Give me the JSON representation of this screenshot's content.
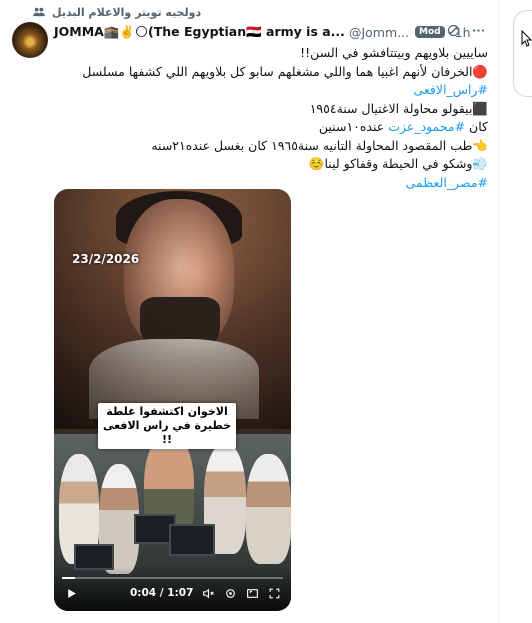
{
  "community": {
    "label": "دولجيه تويتر والاعلام البديل",
    "icon": "people-icon"
  },
  "tweet": {
    "author_name": "JOMMA🕋✌️🌕(The Egyptian🇪🇬 army is a...",
    "handle": "@Jomm...",
    "badge": "Mod",
    "separator": "·",
    "time": "1h",
    "text_lines": [
      "ساييين بلاويهم وبيتتافشو في السن!!",
      "🔴الخرفان لأنهم اغبيا هما واللي مشغلهم سابو كل بلاويهم اللي كشفها مسلسل",
      "#راس_الافعى",
      "⬛بيقولو محاولة الاغتيال سنة١٩٥٤",
      "كان #محمود_عزت عنده١٠سنين",
      "👈طب المقصود المحاولة التانيه سنة١٩٦٥ كان بغسل عنده٢١سنه",
      "💨وشكو في الحيطة وقفاكو لينا☺️",
      "#مصر_العظمى"
    ]
  },
  "video": {
    "overlay_date": "23/2/2026",
    "overlay_caption": "الاخوان اكتشفوا غلطة خطيرة في راس الافعى !!",
    "current_time": "0:04",
    "duration": "1:07",
    "time_display": "0:04 / 1:07",
    "progress_fraction": 0.06
  },
  "colors": {
    "accent": "#1d9bf0",
    "text": "#0f1419",
    "muted": "#536471",
    "badge_bg": "#536471"
  }
}
